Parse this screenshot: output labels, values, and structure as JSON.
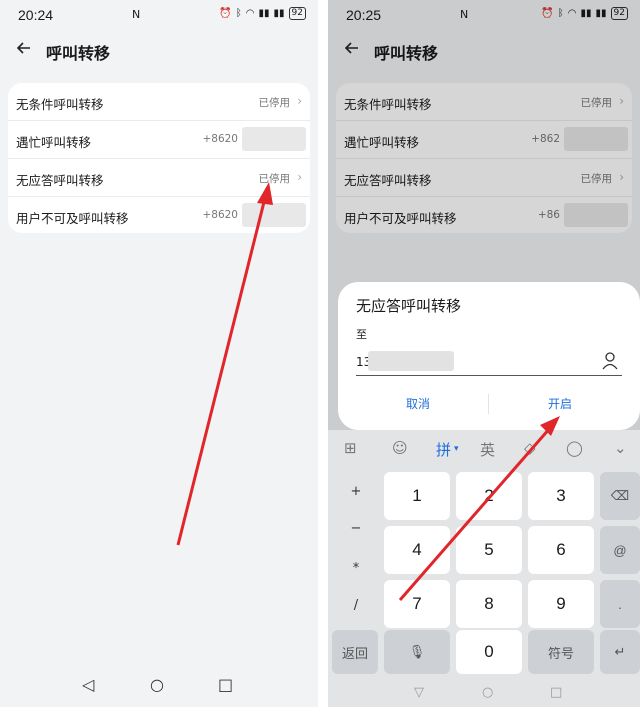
{
  "left": {
    "status": {
      "time": "20:24",
      "battery": "92"
    },
    "title": "呼叫转移",
    "rows": [
      {
        "label": "无条件呼叫转移",
        "value": "已停用"
      },
      {
        "label": "遇忙呼叫转移",
        "value": "+8620"
      },
      {
        "label": "无应答呼叫转移",
        "value": "已停用"
      },
      {
        "label": "用户不可及呼叫转移",
        "value": "+8620"
      }
    ]
  },
  "right": {
    "status": {
      "time": "20:25",
      "battery": "92"
    },
    "title": "呼叫转移",
    "rows": [
      {
        "label": "无条件呼叫转移",
        "value": "已停用"
      },
      {
        "label": "遇忙呼叫转移",
        "value": "+862"
      },
      {
        "label": "无应答呼叫转移",
        "value": "已停用"
      },
      {
        "label": "用户不可及呼叫转移",
        "value": "+86"
      }
    ],
    "dialog": {
      "title": "无应答呼叫转移",
      "to_label": "至",
      "input_value": "13",
      "cancel": "取消",
      "enable": "开启"
    },
    "keyboard": {
      "tool_pinyin": "拼",
      "tool_english": "英",
      "symbols": [
        "+",
        "−",
        "*",
        "/"
      ],
      "digits": [
        "1",
        "2",
        "3",
        "4",
        "5",
        "6",
        "7",
        "8",
        "9"
      ],
      "zero": "0",
      "back": "返回",
      "symbol_key": "符号",
      "at": "@",
      "dot": "."
    }
  },
  "colors": {
    "accent": "#1e6fd9",
    "arrow": "#e0262a"
  }
}
